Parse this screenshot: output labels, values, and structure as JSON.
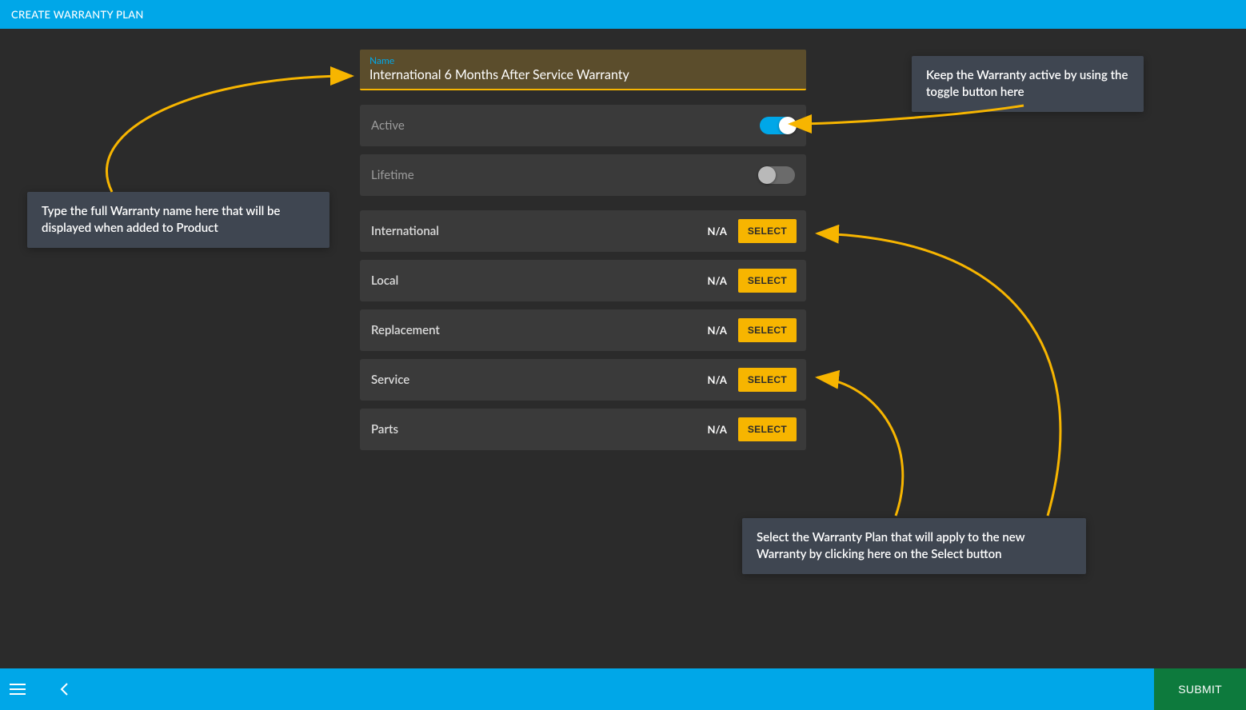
{
  "header": {
    "title": "CREATE WARRANTY PLAN"
  },
  "form": {
    "name_label": "Name",
    "name_value": "International 6 Months After Service Warranty",
    "toggles": [
      {
        "label": "Active",
        "on": true
      },
      {
        "label": "Lifetime",
        "on": false
      }
    ],
    "select_rows": [
      {
        "label": "International",
        "value": "N/A",
        "button": "SELECT"
      },
      {
        "label": "Local",
        "value": "N/A",
        "button": "SELECT"
      },
      {
        "label": "Replacement",
        "value": "N/A",
        "button": "SELECT"
      },
      {
        "label": "Service",
        "value": "N/A",
        "button": "SELECT"
      },
      {
        "label": "Parts",
        "value": "N/A",
        "button": "SELECT"
      }
    ]
  },
  "footer": {
    "submit": "SUBMIT"
  },
  "callouts": {
    "c1": "Type the full Warranty name here that will be displayed when added to Product",
    "c2": "Keep the Warranty active by using the toggle button here",
    "c3": "Select the Warranty Plan that will apply to the new Warranty by clicking here on the Select button"
  }
}
